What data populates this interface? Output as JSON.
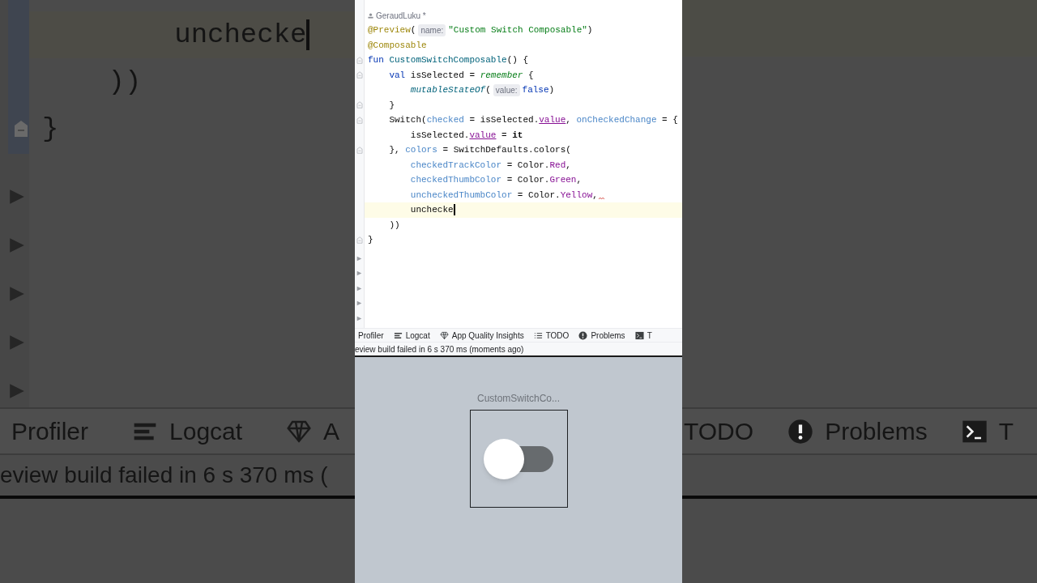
{
  "backdrop": {
    "left": {
      "lines": [
        {
          "text": "        unchecke",
          "current": true,
          "fold": false
        },
        {
          "text": "    ))",
          "current": false,
          "fold": false
        },
        {
          "text": "}",
          "current": false,
          "fold": true
        }
      ],
      "tool_tabs": [
        {
          "label": "Profiler",
          "kind": "none"
        },
        {
          "label": "Logcat",
          "kind": "lines"
        },
        {
          "label": "A",
          "kind": "diamond"
        }
      ],
      "status": "eview build failed in 6 s 370 ms ("
    },
    "right": {
      "tool_tabs": [
        {
          "label": "TODO",
          "kind": "none"
        },
        {
          "label": "Problems",
          "kind": "alert"
        },
        {
          "label": "T",
          "kind": "terminal"
        }
      ]
    }
  },
  "editor": {
    "author": "GeraudLuku *",
    "lines": [
      {
        "tokens": [
          {
            "kind": "annotation",
            "text": "@Preview"
          },
          {
            "kind": "plain",
            "text": "("
          },
          {
            "kind": "hint",
            "text": "name:"
          },
          {
            "kind": "string",
            "text": "\"Custom Switch Composable\""
          },
          {
            "kind": "plain",
            "text": ")"
          }
        ],
        "current": false,
        "fold": false,
        "error": false
      },
      {
        "tokens": [
          {
            "kind": "annotation",
            "text": "@Composable"
          }
        ],
        "current": false,
        "fold": false,
        "error": false
      },
      {
        "tokens": [
          {
            "kind": "keyword",
            "text": "fun "
          },
          {
            "kind": "function",
            "text": "CustomSwitchComposable"
          },
          {
            "kind": "plain",
            "text": "() {"
          }
        ],
        "current": false,
        "fold": true,
        "error": false
      },
      {
        "tokens": [
          {
            "kind": "keyword",
            "text": "    val "
          },
          {
            "kind": "plain",
            "text": "isSelected = "
          },
          {
            "kind": "composable",
            "text": "remember"
          },
          {
            "kind": "plain",
            "text": " {"
          }
        ],
        "current": false,
        "fold": true,
        "error": false
      },
      {
        "tokens": [
          {
            "kind": "call",
            "text": "        mutableStateOf"
          },
          {
            "kind": "plain",
            "text": "("
          },
          {
            "kind": "hint",
            "text": "value:"
          },
          {
            "kind": "keyword",
            "text": "false"
          },
          {
            "kind": "plain",
            "text": ")"
          }
        ],
        "current": false,
        "fold": false,
        "error": false
      },
      {
        "tokens": [
          {
            "kind": "plain",
            "text": "    }"
          }
        ],
        "current": false,
        "fold": true,
        "error": false
      },
      {
        "tokens": [
          {
            "kind": "plain",
            "text": "    Switch("
          },
          {
            "kind": "param",
            "text": "checked"
          },
          {
            "kind": "plain",
            "text": " = isSelected."
          },
          {
            "kind": "property",
            "text": "value"
          },
          {
            "kind": "plain",
            "text": ", "
          },
          {
            "kind": "param",
            "text": "onCheckedChange"
          },
          {
            "kind": "plain",
            "text": " = {"
          }
        ],
        "current": false,
        "fold": true,
        "error": false
      },
      {
        "tokens": [
          {
            "kind": "plain",
            "text": "        isSelected."
          },
          {
            "kind": "property",
            "text": "value"
          },
          {
            "kind": "plain",
            "text": " = "
          },
          {
            "kind": "bold",
            "text": "it"
          }
        ],
        "current": false,
        "fold": false,
        "error": false
      },
      {
        "tokens": [
          {
            "kind": "plain",
            "text": "    }, "
          },
          {
            "kind": "param",
            "text": "colors"
          },
          {
            "kind": "plain",
            "text": " = SwitchDefaults.colors("
          }
        ],
        "current": false,
        "fold": true,
        "error": false
      },
      {
        "tokens": [
          {
            "kind": "param",
            "text": "        checkedTrackColor"
          },
          {
            "kind": "plain",
            "text": " = Color."
          },
          {
            "kind": "constant",
            "text": "Red"
          },
          {
            "kind": "plain",
            "text": ","
          }
        ],
        "current": false,
        "fold": false,
        "error": false
      },
      {
        "tokens": [
          {
            "kind": "param",
            "text": "        checkedThumbColor"
          },
          {
            "kind": "plain",
            "text": " = Color."
          },
          {
            "kind": "constant",
            "text": "Green"
          },
          {
            "kind": "plain",
            "text": ","
          }
        ],
        "current": false,
        "fold": false,
        "error": false
      },
      {
        "tokens": [
          {
            "kind": "param",
            "text": "        uncheckedThumbColor"
          },
          {
            "kind": "plain",
            "text": " = Color."
          },
          {
            "kind": "constant",
            "text": "Yellow"
          },
          {
            "kind": "plain",
            "text": ","
          }
        ],
        "current": false,
        "fold": false,
        "error": true
      },
      {
        "tokens": [
          {
            "kind": "plain",
            "text": "        unchecke"
          }
        ],
        "current": true,
        "fold": false,
        "error": false
      },
      {
        "tokens": [
          {
            "kind": "plain",
            "text": "    ))"
          }
        ],
        "current": false,
        "fold": false,
        "error": false
      },
      {
        "tokens": [
          {
            "kind": "plain",
            "text": "}"
          }
        ],
        "current": false,
        "fold": true,
        "error": false
      }
    ],
    "tool_tabs": [
      {
        "label": "Profiler",
        "kind": "none"
      },
      {
        "label": "Logcat",
        "kind": "lines"
      },
      {
        "label": "App Quality Insights",
        "kind": "diamond"
      },
      {
        "label": "TODO",
        "kind": "list"
      },
      {
        "label": "Problems",
        "kind": "alert"
      },
      {
        "label": "T",
        "kind": "terminal"
      }
    ],
    "status": "eview build failed in 6 s 370 ms (moments ago)"
  },
  "preview": {
    "title": "CustomSwitchCo...",
    "switch": {
      "checked": false
    }
  }
}
